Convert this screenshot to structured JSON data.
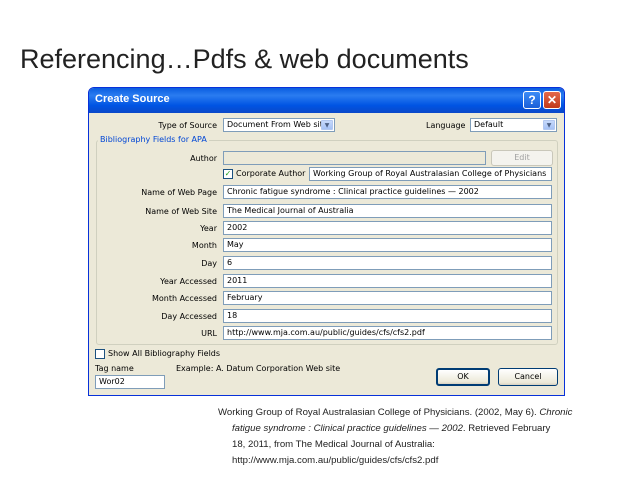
{
  "slide": {
    "title": "Referencing…Pdfs & web documents"
  },
  "dialog": {
    "title": "Create Source",
    "help_glyph": "?",
    "close_glyph": "✕",
    "type_of_source_label": "Type of Source",
    "type_of_source_value": "Document From Web site",
    "language_label": "Language",
    "language_value": "Default",
    "group_label": "Bibliography Fields for APA",
    "author_label": "Author",
    "author_value": "",
    "edit_label": "Edit",
    "corporate_author_label": "Corporate Author",
    "corporate_author_checked": "✓",
    "corporate_author_value": "Working Group of Royal Australasian College of Physicians",
    "fields": [
      {
        "label": "Name of Web Page",
        "value": "Chronic fatigue syndrome : Clinical practice guidelines — 2002"
      },
      {
        "label": "Name of Web Site",
        "value": "The Medical Journal of Australia"
      },
      {
        "label": "Year",
        "value": "2002"
      },
      {
        "label": "Month",
        "value": "May"
      },
      {
        "label": "Day",
        "value": "6"
      },
      {
        "label": "Year Accessed",
        "value": "2011"
      },
      {
        "label": "Month Accessed",
        "value": "February"
      },
      {
        "label": "Day Accessed",
        "value": "18"
      },
      {
        "label": "URL",
        "value": "http://www.mja.com.au/public/guides/cfs/cfs2.pdf"
      }
    ],
    "show_all_label": "Show All Bibliography Fields",
    "tag_name_label": "Tag name",
    "example_text": "Example: A. Datum Corporation Web site",
    "tag_value": "Wor02",
    "ok_label": "OK",
    "cancel_label": "Cancel"
  },
  "reference": {
    "line1_plain": "Working Group of Royal Australasian College of Physicians. (2002, May 6). ",
    "line1_italic": "Chronic",
    "line2_italic": "fatigue syndrome : Clinical practice guidelines — 2002",
    "line2_plain": ". Retrieved February",
    "line3": "18, 2011, from The Medical Journal of Australia:",
    "line4": "http://www.mja.com.au/public/guides/cfs/cfs2.pdf"
  }
}
